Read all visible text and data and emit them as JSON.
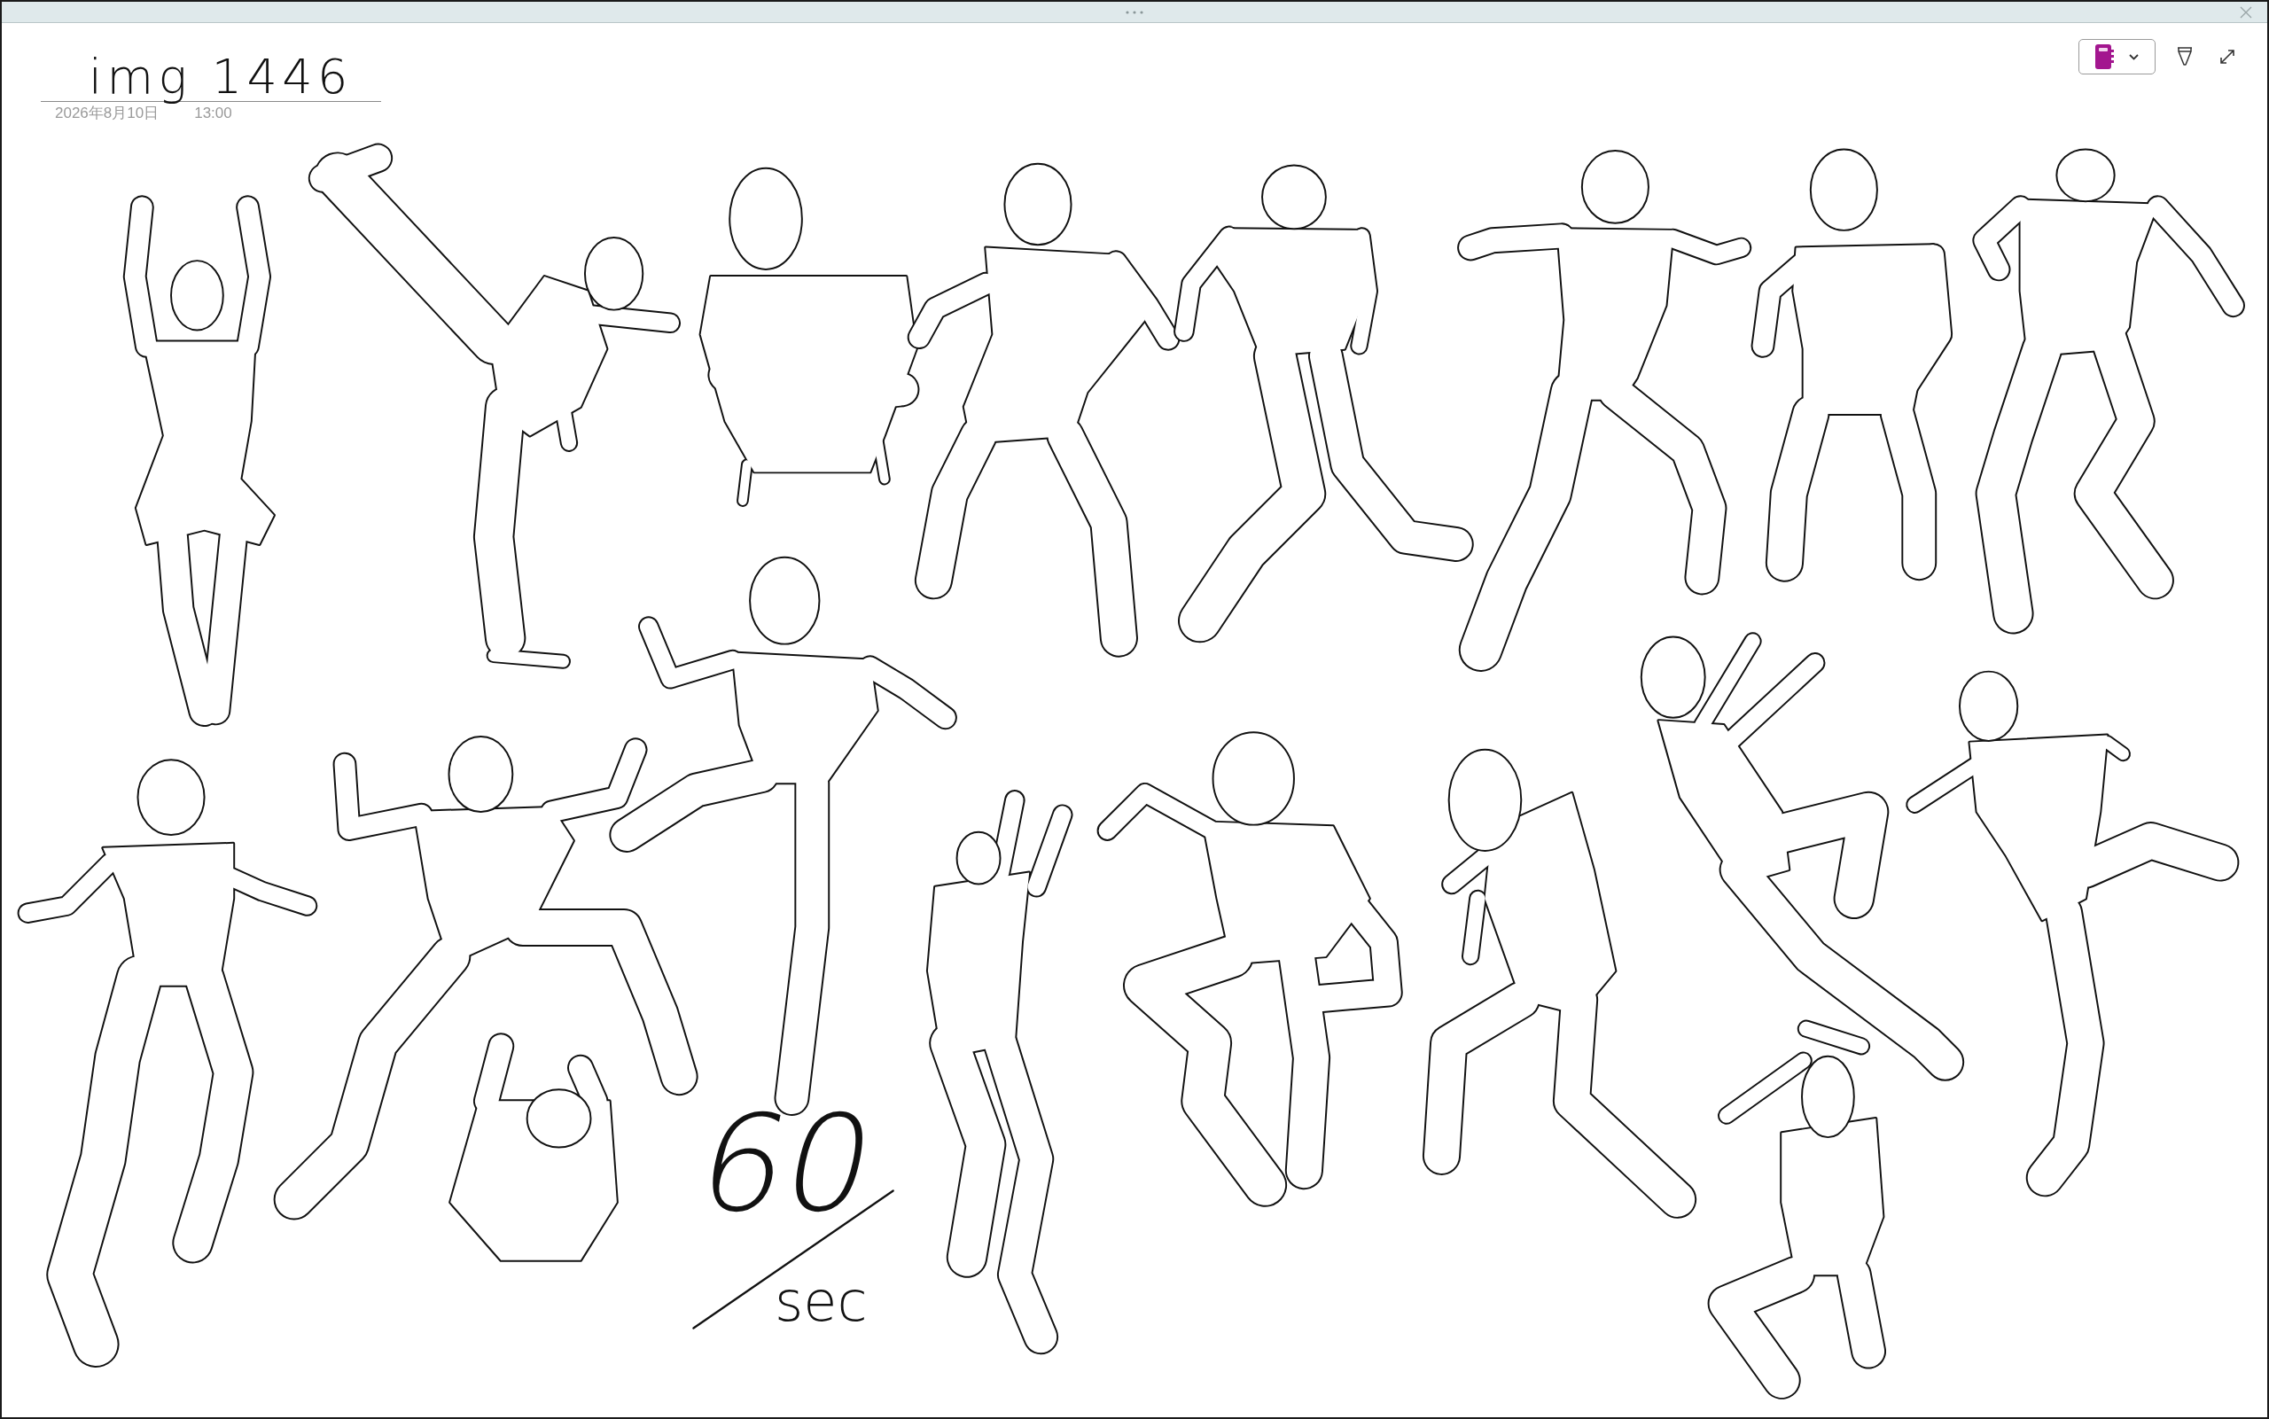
{
  "page": {
    "title": "img 1446",
    "date": "2026年8月10日",
    "time": "13:00"
  },
  "ink_note": {
    "number": "60",
    "unit": "sec"
  }
}
